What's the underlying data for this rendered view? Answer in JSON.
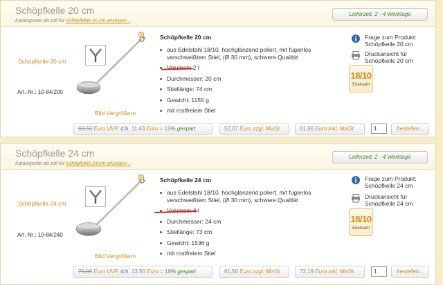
{
  "products": [
    {
      "title": "Schöpfkelle 20 cm",
      "catalog_prefix": "Katalogseite als pdf für ",
      "catalog_link": "Schöpfkelle 20 cm anzeigen...",
      "delivery": "Lieferzeit: 2 - 4 Werktage",
      "left_name": "Schöpfkelle 20 cm",
      "artno": "Art.-Nr.: 10-84/200",
      "enlarge": "Bild Vergrößern",
      "desc_title": "Schöpfkelle 20 cm",
      "features": [
        "aus Edelstahl 18/10, hochglänzend poliert, mit fugenlos verschweißtem Stiel, (Ø 30 mm), schwere Qualität",
        "Volumen: 2 l",
        "Durchmesser: 20 cm",
        "Stiellänge: 74 cm",
        "Gewicht: 1155 g",
        "mit rostfreiem Stiel"
      ],
      "question": "Frage zum Produkt: Schöpfkelle 20 cm",
      "print": "Druckansicht für Schöpfkelle 20 cm",
      "badge_big": "18/10",
      "badge_small": "Edelstahl",
      "old_price": "63,50",
      "uvp_label": "Euro UVP,",
      "dh_label": "d.h.",
      "discount_price": "11,43",
      "euro_eq": "Euro =",
      "percent": "18",
      "spart": "% gespart",
      "net_price": "52,07",
      "net_label": "Euro zzgl. MwSt.",
      "gross_price": "61,96",
      "gross_label": "Euro inkl. MwSt.",
      "qty": "1",
      "order": "bestellen..."
    },
    {
      "title": "Schöpfkelle 24 cm",
      "catalog_prefix": "Katalogseite als pdf für ",
      "catalog_link": "Schöpfkelle 24 cm anzeigen...",
      "delivery": "Lieferzeit: 2 - 4 Werktage",
      "left_name": "Schöpfkelle 24 cm",
      "artno": "Art.-Nr.: 10-84/240",
      "enlarge": "Bild Vergrößern",
      "desc_title": "Schöpfkelle 24 cm",
      "features": [
        "aus Edelstahl 18/10, hochglänzend poliert, mit fugenlos verschweißtem Stiel, (Ø 30 mm), schwere Qualität",
        "Volumen: 4 l",
        "Durchmesser: 24 cm",
        "Stiellänge: 73 cm",
        "Gewicht: 1536 g",
        "mit rostfreiem Stiel"
      ],
      "question": "Frage zum Produkt: Schöpfkelle 24 cm",
      "print": "Druckansicht für Schöpfkelle 24 cm",
      "badge_big": "18/10",
      "badge_small": "Edelstahl",
      "old_price": "75,00",
      "uvp_label": "Euro UVP,",
      "dh_label": "d.h.",
      "discount_price": "13,50",
      "euro_eq": "Euro =",
      "percent": "18",
      "spart": "% gespart",
      "net_price": "61,50",
      "net_label": "Euro zzgl. MwSt.",
      "gross_price": "73,19",
      "gross_label": "Euro inkl. MwSt.",
      "qty": "1",
      "order": "bestellen..."
    }
  ],
  "colors": {
    "background": "#f7edcb",
    "accent": "#d18a1a",
    "green": "#3b8a1e",
    "highlight": "#dd2222"
  },
  "icons": [
    "zoom-icon",
    "category-icon",
    "info-icon",
    "printer-icon"
  ]
}
